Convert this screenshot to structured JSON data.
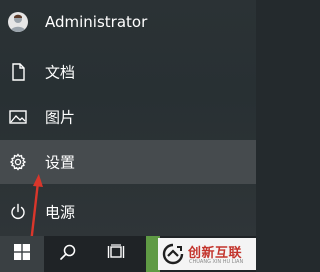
{
  "start_menu": {
    "user": {
      "name": "Administrator",
      "icon": "user-avatar"
    },
    "items": [
      {
        "id": "documents",
        "label": "文档",
        "icon": "document-icon"
      },
      {
        "id": "pictures",
        "label": "图片",
        "icon": "picture-icon"
      },
      {
        "id": "settings",
        "label": "设置",
        "icon": "gear-icon",
        "highlighted": true
      },
      {
        "id": "power",
        "label": "电源",
        "icon": "power-icon"
      }
    ]
  },
  "taskbar": {
    "buttons": [
      {
        "id": "start",
        "icon": "windows-logo-icon"
      },
      {
        "id": "search",
        "icon": "search-icon"
      },
      {
        "id": "task-view",
        "icon": "task-view-icon"
      }
    ]
  },
  "watermark": {
    "text": "创新互联",
    "subtext": "CHUANG XIN HU LIAN",
    "color": "#c3342c"
  },
  "colors": {
    "menu_bg": "#2b3235",
    "highlight_bg": "#464b4e",
    "taskbar_bg": "#1f2326",
    "arrow": "#d9362b"
  }
}
